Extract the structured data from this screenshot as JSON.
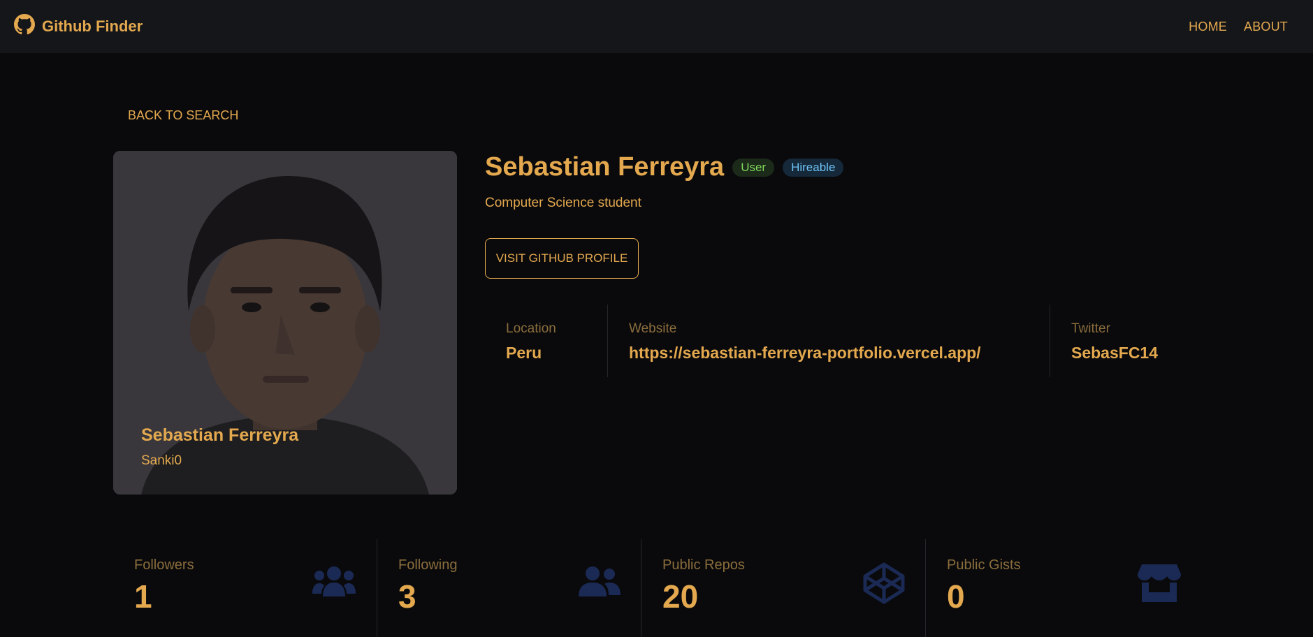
{
  "navbar": {
    "brand": "Github Finder",
    "links": [
      {
        "label": "HOME"
      },
      {
        "label": "ABOUT"
      }
    ]
  },
  "back_button": "BACK TO SEARCH",
  "profile": {
    "name": "Sebastian Ferreyra",
    "login": "Sanki0",
    "type_badge": "User",
    "hireable_badge": "Hireable",
    "bio": "Computer Science student",
    "visit_button": "VISIT GITHUB PROFILE"
  },
  "info": [
    {
      "label": "Location",
      "value": "Peru"
    },
    {
      "label": "Website",
      "value": "https://sebastian-ferreyra-portfolio.vercel.app/"
    },
    {
      "label": "Twitter",
      "value": "SebasFC14"
    }
  ],
  "stats": [
    {
      "label": "Followers",
      "value": "1",
      "icon": "users-icon"
    },
    {
      "label": "Following",
      "value": "3",
      "icon": "user-friends-icon"
    },
    {
      "label": "Public Repos",
      "value": "20",
      "icon": "codepen-icon"
    },
    {
      "label": "Public Gists",
      "value": "0",
      "icon": "store-icon"
    }
  ],
  "colors": {
    "background": "#0a0a0c",
    "navbar": "#15161a",
    "accent": "#e4a94f",
    "icon": "#1b2a55",
    "badge_user": "#7fd85a",
    "badge_hireable": "#6fc3f5"
  }
}
